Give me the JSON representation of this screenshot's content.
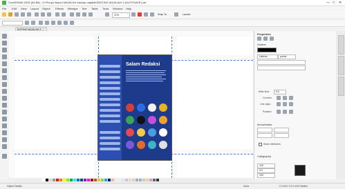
{
  "window": {
    "title": "CorelDRAW 2020 (64-Bit) - D:\\Punya \\layout MAJALAH backup majalah\\EDITING MAJALAH 2 (AUTOSAVE).cdr"
  },
  "menu": [
    "File",
    "Edit",
    "View",
    "Layout",
    "Object",
    "Effects",
    "Bitmaps",
    "Text",
    "Table",
    "Tools",
    "Window",
    "Help"
  ],
  "toolbar": {
    "zoom": "37%",
    "snap_to": "Snap To",
    "launch": "Launch"
  },
  "document_tab": "EDITING MAJALAH 2 ...",
  "page": {
    "heading": "Salam Redaksi",
    "colors": {
      "bg": "#1e3a8a",
      "band": "#2c4fb0",
      "accent": "#9fb6ec"
    }
  },
  "panel": {
    "title": "Properties",
    "section_outline": "Outline",
    "hairline": "Hairline",
    "units": "points",
    "miter_limit_label": "Miter limit:",
    "miter_limit_value": "5.0",
    "corners_label": "Corners:",
    "line_caps_label": "Line caps:",
    "position_label": "Position:",
    "arrowheads_label": "Arrowheads",
    "share_attributes": "Share Attributes",
    "calligraphy_label": "Calligraphy",
    "stretch_value": "100",
    "angle_value": "0.0",
    "spread_value": "100",
    "overprint": "Overprint outline"
  },
  "status": {
    "left": "Object Details",
    "fill": "None",
    "outline": "C:0 M:0 Y:0 K:100 Hairline"
  },
  "palette_colors": [
    "#ffffff",
    "#000000",
    "#d6d6d6",
    "#9a9a9a",
    "#ff0000",
    "#ff7f00",
    "#ffff00",
    "#7fff00",
    "#00b050",
    "#00ffff",
    "#0070c0",
    "#1e3a8a",
    "#7030a0",
    "#ff00ff",
    "#c00000",
    "#996633",
    "#ffc000",
    "#92d050",
    "#00b0f0",
    "#002060",
    "#e6b8b7",
    "#fde9d9",
    "#ebf1dd",
    "#dbe5f1",
    "#ccc0da",
    "#fbd4b4",
    "#b7dee8",
    "#d99694",
    "#8eb4e3",
    "#c3d69b",
    "#ffcc99",
    "#cc99ff",
    "#666666",
    "#333333"
  ]
}
